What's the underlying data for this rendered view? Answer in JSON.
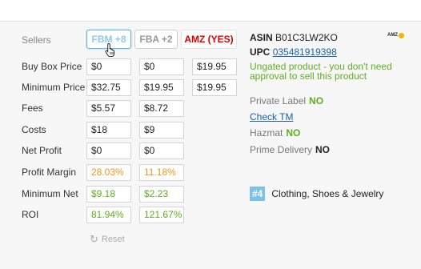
{
  "labels": [
    "Sellers",
    "Buy Box Price",
    "Minimum Price",
    "Fees",
    "Costs",
    "Net Profit",
    "Profit Margin",
    "Minimum Net",
    "ROI"
  ],
  "seller_buttons": {
    "fbm": "FBM +8",
    "fba": "FBA +2",
    "amz": "AMZ (YES)"
  },
  "rows": {
    "buy_box": [
      "$0",
      "$0",
      "$19.95"
    ],
    "min_price": [
      "$32.75",
      "$19.95",
      "$19.95"
    ],
    "fees": [
      "$5.57",
      "$8.72"
    ],
    "costs": [
      "$18",
      "$9"
    ],
    "net_profit": [
      "$0",
      "$0"
    ],
    "profit_margin": [
      "28.03%",
      "11.18%"
    ],
    "minimum_net": [
      "$9.18",
      "$2.23"
    ],
    "roi": [
      "81.94%",
      "121.67%"
    ]
  },
  "product": {
    "asin_label": "ASIN",
    "asin": "B01C3LW2KO",
    "upc_label": "UPC",
    "upc": "035481919398",
    "ungated": "Ungated product - you don't need approval to sell this product",
    "private_label": "Private Label",
    "private_label_value": "NO",
    "check_tm": "Check TM",
    "hazmat": "Hazmat",
    "hazmat_value": "NO",
    "prime_delivery": "Prime Delivery",
    "prime_delivery_value": "NO",
    "rank": "#4",
    "category": "Clothing, Shoes & Jewelry",
    "logo": "AMZ"
  },
  "reset_label": "Reset",
  "colors": {
    "green": "#5fae20",
    "orange": "#f0961e",
    "link": "#1a5fb4",
    "badge": "#7cc2e6",
    "amz_red": "#e00000"
  }
}
